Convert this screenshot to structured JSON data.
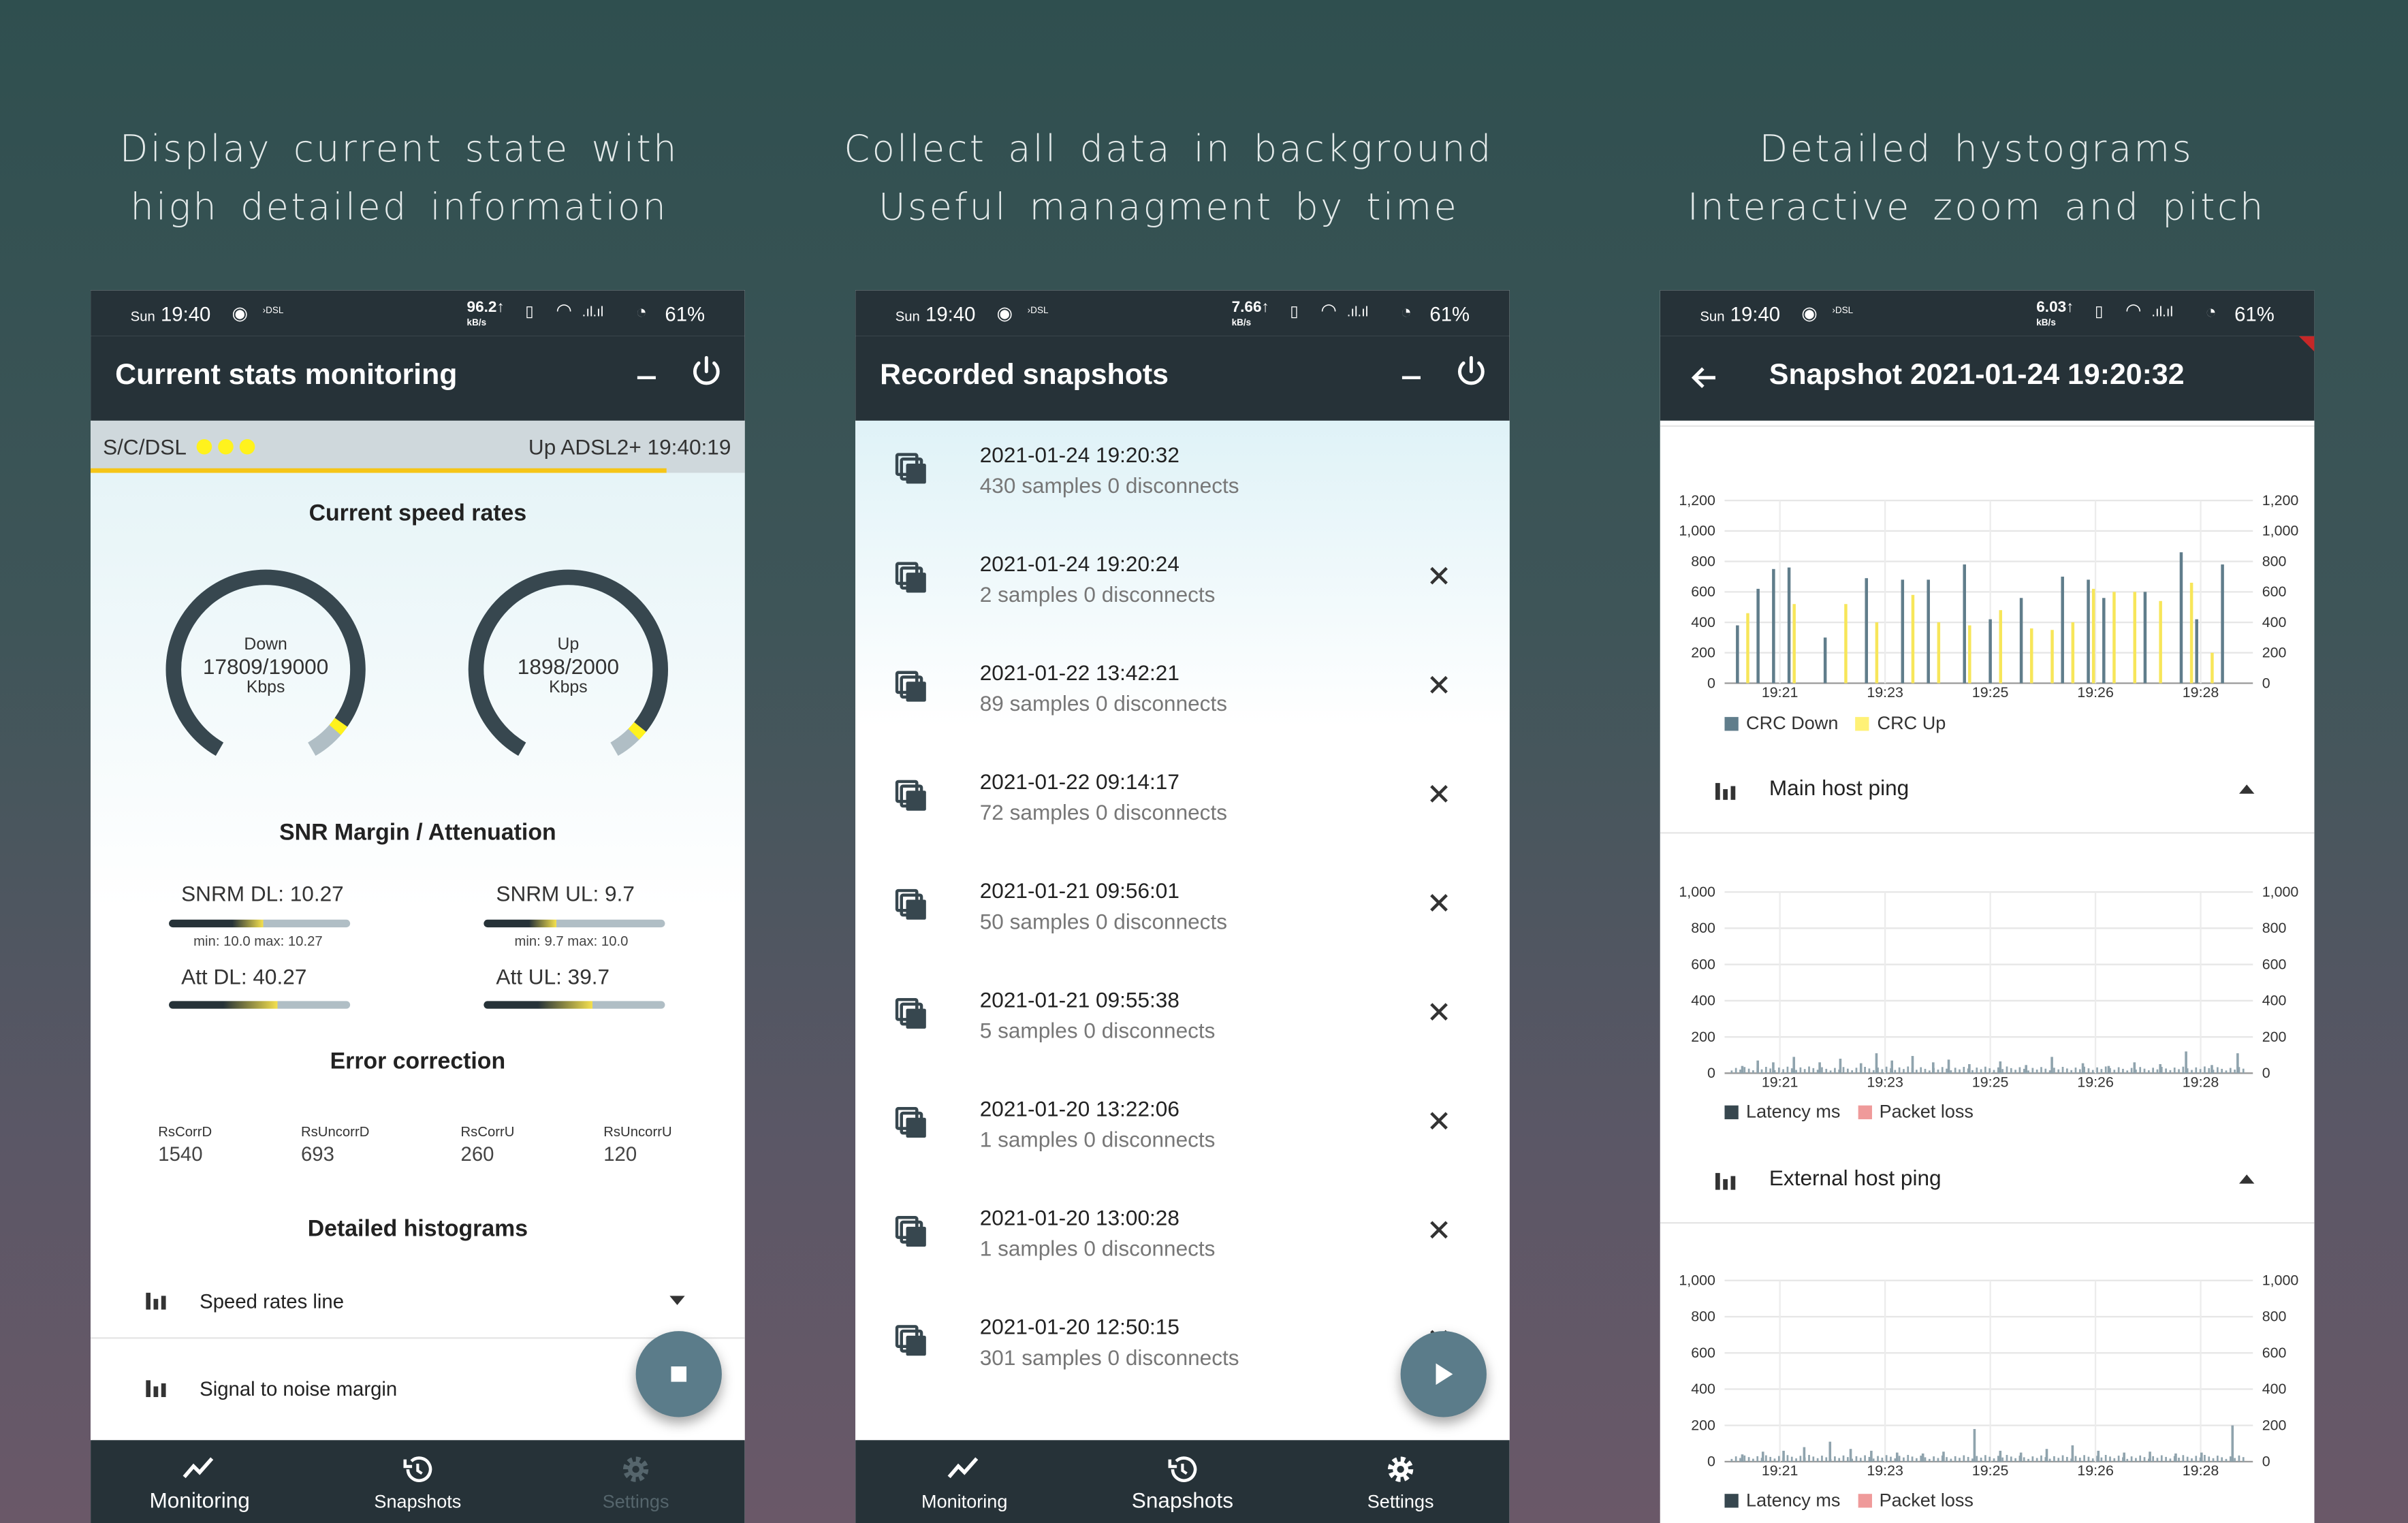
{
  "captions": [
    {
      "line1": "Display current state with",
      "line2": "high detailed information"
    },
    {
      "line1": "Collect all data in background",
      "line2": "Useful managment by time"
    },
    {
      "line1": "Detailed hystograms",
      "line2": "Interactive zoom and pitch"
    }
  ],
  "statusbar": [
    {
      "day": "Sun",
      "time": "19:40",
      "speed": "96.2",
      "speed_unit": "kB/s",
      "battery": "61%"
    },
    {
      "day": "Sun",
      "time": "19:40",
      "speed": "7.66",
      "speed_unit": "kB/s",
      "battery": "61%"
    },
    {
      "day": "Sun",
      "time": "19:40",
      "speed": "6.03",
      "speed_unit": "kB/s",
      "battery": "61%"
    }
  ],
  "monitoring": {
    "title": "Current stats monitoring",
    "infobar_left": "S/C/DSL",
    "infobar_right": "Up  ADSL2+  19:40:19",
    "progress": 0.88,
    "speed_section": "Current speed rates",
    "down": {
      "label": "Down",
      "value": "17809/19000",
      "unit": "Kbps",
      "fraction": 0.937
    },
    "up": {
      "label": "Up",
      "value": "1898/2000",
      "unit": "Kbps",
      "fraction": 0.949
    },
    "snr_section": "SNR Margin / Attenuation",
    "snrm_dl": "SNRM DL: 10.27",
    "snrm_dl_minmax": "min: 10.0 max: 10.27",
    "snrm_ul": "SNRM UL: 9.7",
    "snrm_ul_minmax": "min: 9.7  max: 10.0",
    "att_dl": "Att DL: 40.27",
    "att_ul": "Att UL: 39.7",
    "error_section": "Error correction",
    "errors": [
      {
        "label": "RsCorrD",
        "value": "1540"
      },
      {
        "label": "RsUncorrD",
        "value": "693"
      },
      {
        "label": "RsCorrU",
        "value": "260"
      },
      {
        "label": "RsUncorrU",
        "value": "120"
      }
    ],
    "hist_section": "Detailed histograms",
    "hist_items": [
      "Speed rates line",
      "Signal to noise margin"
    ]
  },
  "snapshots": {
    "title": "Recorded snapshots",
    "items": [
      {
        "date": "2021-01-24 19:20:32",
        "info": "430 samples  0 disconnects"
      },
      {
        "date": "2021-01-24 19:20:24",
        "info": "2 samples  0 disconnects"
      },
      {
        "date": "2021-01-22 13:42:21",
        "info": "89 samples  0 disconnects"
      },
      {
        "date": "2021-01-22 09:14:17",
        "info": "72 samples  0 disconnects"
      },
      {
        "date": "2021-01-21 09:56:01",
        "info": "50 samples  0 disconnects"
      },
      {
        "date": "2021-01-21 09:55:38",
        "info": "5 samples  0 disconnects"
      },
      {
        "date": "2021-01-20 13:22:06",
        "info": "1 samples  0 disconnects"
      },
      {
        "date": "2021-01-20 13:00:28",
        "info": "1 samples  0 disconnects"
      },
      {
        "date": "2021-01-20 12:50:15",
        "info": "301 samples  0 disconnects"
      }
    ]
  },
  "snapshot_detail": {
    "title": "Snapshot 2021-01-24 19:20:32",
    "section_main": "Main host ping",
    "section_external": "External host ping"
  },
  "nav": {
    "monitoring": "Monitoring",
    "snapshots": "Snapshots",
    "settings": "Settings"
  },
  "colors": {
    "dark": "#263238",
    "accent": "#fff21d",
    "crc_down": "#607d8b",
    "crc_up": "#fff176",
    "latency": "#37474f",
    "packet_loss": "#ef9a9a",
    "fab": "#5b7c8a"
  },
  "chart_data": [
    {
      "type": "bar",
      "x_ticks": [
        "19:21",
        "19:23",
        "19:25",
        "19:26",
        "19:28"
      ],
      "y_ticks": [
        "0",
        "200",
        "400",
        "600",
        "800",
        "1,000",
        "1,200"
      ],
      "ylim": [
        0,
        1200
      ],
      "series": [
        {
          "name": "CRC Down",
          "spikes": [
            [
              0.01,
              380
            ],
            [
              0.05,
              620
            ],
            [
              0.08,
              750
            ],
            [
              0.11,
              760
            ],
            [
              0.18,
              300
            ],
            [
              0.26,
              690
            ],
            [
              0.33,
              680
            ],
            [
              0.38,
              680
            ],
            [
              0.45,
              780
            ],
            [
              0.5,
              420
            ],
            [
              0.56,
              560
            ],
            [
              0.64,
              700
            ],
            [
              0.69,
              680
            ],
            [
              0.72,
              560
            ],
            [
              0.8,
              600
            ],
            [
              0.87,
              860
            ],
            [
              0.9,
              420
            ],
            [
              0.95,
              780
            ]
          ]
        },
        {
          "name": "CRC Up",
          "spikes": [
            [
              0.03,
              460
            ],
            [
              0.12,
              520
            ],
            [
              0.22,
              520
            ],
            [
              0.28,
              400
            ],
            [
              0.35,
              580
            ],
            [
              0.4,
              400
            ],
            [
              0.46,
              380
            ],
            [
              0.52,
              480
            ],
            [
              0.58,
              360
            ],
            [
              0.62,
              350
            ],
            [
              0.66,
              400
            ],
            [
              0.7,
              620
            ],
            [
              0.74,
              600
            ],
            [
              0.78,
              600
            ],
            [
              0.83,
              540
            ],
            [
              0.89,
              660
            ],
            [
              0.93,
              200
            ]
          ]
        }
      ]
    },
    {
      "type": "bar",
      "x_ticks": [
        "19:21",
        "19:23",
        "19:25",
        "19:26",
        "19:28"
      ],
      "y_ticks": [
        "0",
        "200",
        "400",
        "600",
        "800",
        "1,000"
      ],
      "ylim": [
        0,
        1000
      ],
      "series": [
        {
          "name": "Latency ms",
          "spikes": [
            [
              0.02,
              40
            ],
            [
              0.05,
              70
            ],
            [
              0.08,
              60
            ],
            [
              0.12,
              90
            ],
            [
              0.17,
              60
            ],
            [
              0.21,
              80
            ],
            [
              0.25,
              55
            ],
            [
              0.28,
              110
            ],
            [
              0.31,
              70
            ],
            [
              0.35,
              95
            ],
            [
              0.39,
              60
            ],
            [
              0.42,
              75
            ],
            [
              0.46,
              50
            ],
            [
              0.52,
              65
            ],
            [
              0.57,
              45
            ],
            [
              0.62,
              90
            ],
            [
              0.68,
              55
            ],
            [
              0.73,
              40
            ],
            [
              0.78,
              60
            ],
            [
              0.83,
              50
            ],
            [
              0.88,
              120
            ],
            [
              0.93,
              45
            ],
            [
              0.98,
              110
            ]
          ]
        },
        {
          "name": "Packet loss",
          "spikes": []
        }
      ]
    },
    {
      "type": "bar",
      "x_ticks": [
        "19:21",
        "19:23",
        "19:25",
        "19:26",
        "19:28"
      ],
      "y_ticks": [
        "0",
        "200",
        "400",
        "600",
        "800",
        "1,000"
      ],
      "ylim": [
        0,
        1000
      ],
      "series": [
        {
          "name": "Latency ms",
          "spikes": [
            [
              0.02,
              40
            ],
            [
              0.06,
              55
            ],
            [
              0.1,
              60
            ],
            [
              0.14,
              80
            ],
            [
              0.19,
              110
            ],
            [
              0.23,
              70
            ],
            [
              0.27,
              60
            ],
            [
              0.32,
              50
            ],
            [
              0.37,
              45
            ],
            [
              0.41,
              55
            ],
            [
              0.47,
              180
            ],
            [
              0.52,
              60
            ],
            [
              0.56,
              50
            ],
            [
              0.61,
              70
            ],
            [
              0.66,
              90
            ],
            [
              0.71,
              60
            ],
            [
              0.76,
              50
            ],
            [
              0.81,
              55
            ],
            [
              0.86,
              45
            ],
            [
              0.91,
              50
            ],
            [
              0.97,
              200
            ]
          ]
        },
        {
          "name": "Packet loss",
          "spikes": []
        }
      ]
    }
  ]
}
